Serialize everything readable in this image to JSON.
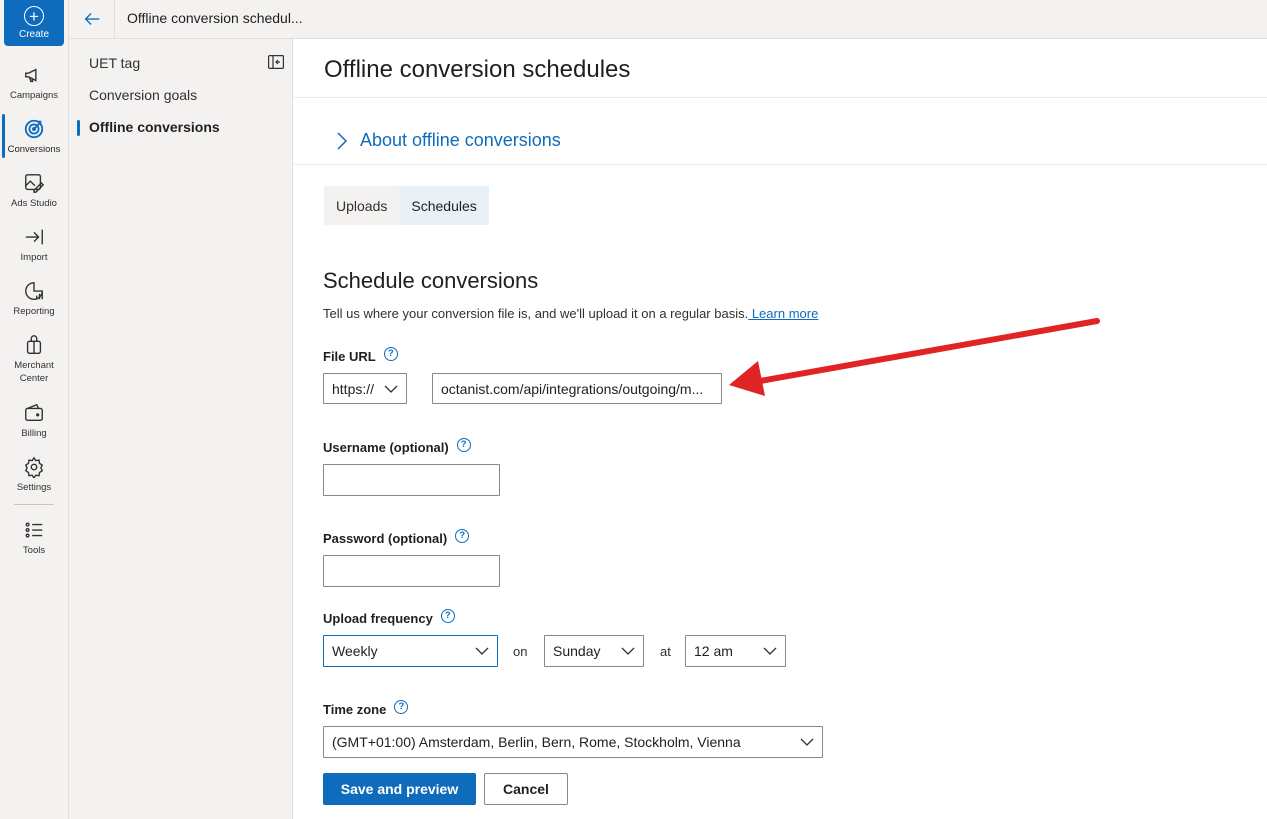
{
  "rail": {
    "create_label": "Create",
    "items": [
      {
        "label": "Campaigns",
        "icon": "megaphone-icon"
      },
      {
        "label": "Conversions",
        "icon": "target-icon"
      },
      {
        "label": "Ads Studio",
        "icon": "image-edit-icon"
      },
      {
        "label": "Import",
        "icon": "import-arrow-icon"
      },
      {
        "label": "Reporting",
        "icon": "report-chart-icon"
      },
      {
        "label": "Merchant\nCenter",
        "icon": "shopping-bag-icon"
      },
      {
        "label": "Billing",
        "icon": "wallet-icon"
      },
      {
        "label": "Settings",
        "icon": "gear-icon"
      },
      {
        "label": "Tools",
        "icon": "tools-list-icon"
      }
    ],
    "active": "Conversions"
  },
  "topbar": {
    "title": "Offline conversion schedul..."
  },
  "subnav": {
    "items": [
      {
        "label": "UET tag"
      },
      {
        "label": "Conversion goals"
      },
      {
        "label": "Offline conversions"
      }
    ],
    "active": "Offline conversions"
  },
  "main": {
    "title": "Offline conversion schedules",
    "about_label": "About offline conversions",
    "tabs": [
      {
        "label": "Uploads"
      },
      {
        "label": "Schedules"
      }
    ],
    "selected_tab": "Schedules",
    "section_title": "Schedule conversions",
    "description": "Tell us where your conversion file is, and we'll upload it on a regular basis.",
    "learn_more": " Learn more",
    "file_url": {
      "label": "File URL",
      "protocol": "https://",
      "value": "octanist.com/api/integrations/outgoing/m..."
    },
    "username": {
      "label": "Username (optional)",
      "value": ""
    },
    "password": {
      "label": "Password (optional)",
      "value": ""
    },
    "upload_frequency": {
      "label": "Upload frequency",
      "frequency": "Weekly",
      "on_label": "on",
      "day": "Sunday",
      "at_label": "at",
      "time": "12 am"
    },
    "time_zone": {
      "label": "Time zone",
      "value": "(GMT+01:00) Amsterdam, Berlin, Bern, Rome, Stockholm, Vienna"
    },
    "save_label": "Save and preview",
    "cancel_label": "Cancel"
  },
  "help_glyph": "?",
  "colors": {
    "accent": "#0f6cbd",
    "annotation_arrow": "#e02424"
  }
}
